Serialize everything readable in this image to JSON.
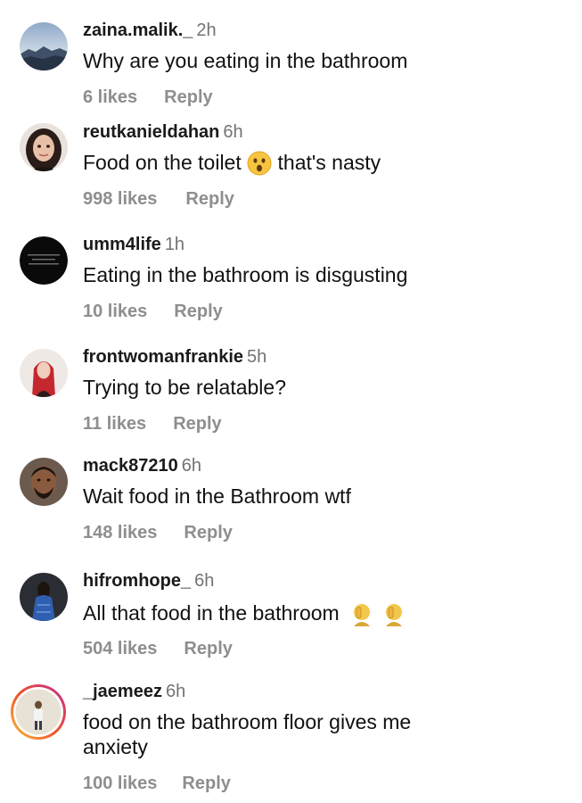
{
  "comments": [
    {
      "username": "zaina.malik._",
      "time": "2h",
      "text": "Why are you eating in the bathroom",
      "likes": "6 likes",
      "reply": "Reply",
      "avatar": "mountain-landscape-avatar"
    },
    {
      "username": "reutkanieldahan",
      "time": "6h",
      "text_before": "Food on the toilet",
      "text_emoji": "astonished-face",
      "text_after": "that's nasty",
      "likes": "998 likes",
      "reply": "Reply",
      "avatar": "woman-face-avatar"
    },
    {
      "username": "umm4life",
      "time": "1h",
      "text": "Eating in the bathroom is disgusting",
      "likes": "10 likes",
      "reply": "Reply",
      "avatar": "black-text-avatar"
    },
    {
      "username": "frontwomanfrankie",
      "time": "5h",
      "text": "Trying to be relatable?",
      "likes": "11 likes",
      "reply": "Reply",
      "avatar": "red-hair-woman-avatar"
    },
    {
      "username": "mack87210",
      "time": "6h",
      "text": "Wait food in the Bathroom wtf",
      "likes": "148 likes",
      "reply": "Reply",
      "avatar": "man-face-avatar"
    },
    {
      "username": "hifromhope_",
      "time": "6h",
      "text": "All that food in the bathroom",
      "text_emoji": "facepalm-emoji",
      "likes": "504 likes",
      "reply": "Reply",
      "avatar": "woman-blue-dress-avatar"
    },
    {
      "username": "_jaemeez",
      "time": "6h",
      "text_line1": "food on the bathroom floor gives me",
      "text_line2": "anxiety",
      "likes": "100 likes",
      "reply": "Reply",
      "avatar": "person-story-ring-avatar"
    }
  ]
}
